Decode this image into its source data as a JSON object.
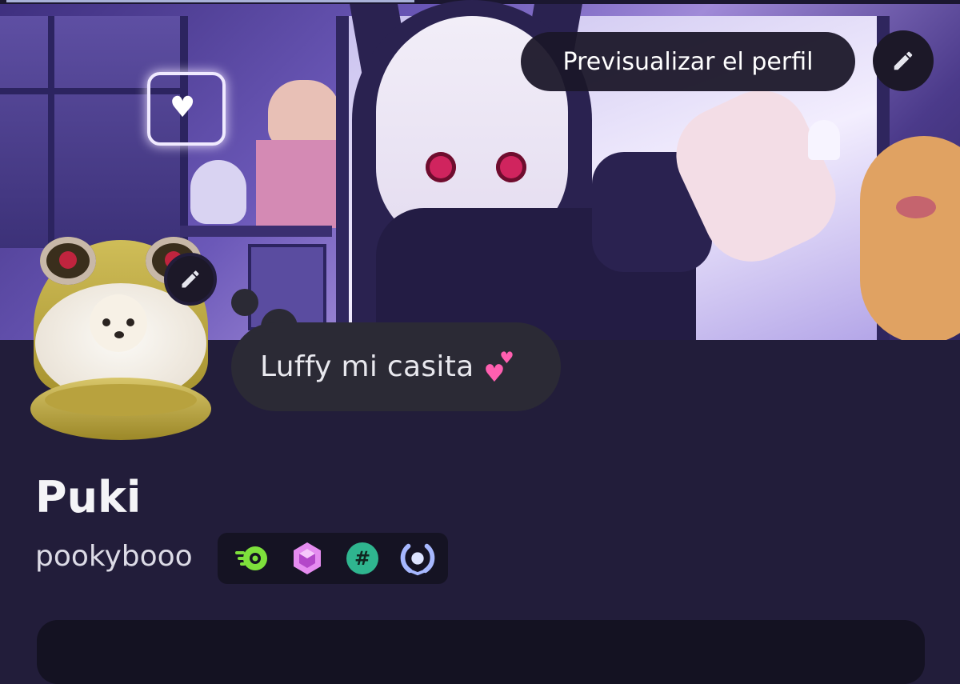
{
  "banner": {
    "preview_button_label": "Previsualizar el perfil",
    "edit_icon": "pencil-icon"
  },
  "avatar": {
    "description_icon": "avatar-image",
    "edit_icon": "pencil-icon"
  },
  "status": {
    "text": "Luffy mi casita",
    "emoji_icon": "two-hearts-icon"
  },
  "profile": {
    "display_name": "Puki",
    "username": "pookybooo"
  },
  "badges": [
    {
      "icon": "nitro-badge-icon",
      "color": "#7ee03c"
    },
    {
      "icon": "boost-gem-badge-icon",
      "color": "#e58cf0"
    },
    {
      "icon": "hashtag-badge-icon",
      "color": "#2fb58f"
    },
    {
      "icon": "quest-laurel-badge-icon",
      "color": "#a7b8ff"
    }
  ],
  "colors": {
    "background": "#221d3a",
    "bubble": "#2b2a35",
    "badge_strip": "#151323",
    "button_dark": "#1c1828"
  }
}
